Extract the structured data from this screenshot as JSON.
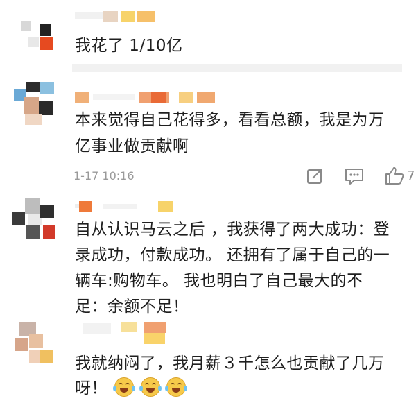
{
  "colors": {
    "text": "#1f1f1f",
    "meta": "#9a9a9a",
    "blur_orange": "#f08a3a",
    "blur_yellow": "#f7d36a",
    "blur_red": "#e24a2a"
  },
  "comments": [
    {
      "text": "我花了 1/10亿"
    },
    {
      "text_line1": "本来觉得自己花得多，看看总额，我是为万",
      "text_line2": "亿事业做贡献啊",
      "time": "1-17 10:16",
      "like_count": "7",
      "icons": [
        "share-icon",
        "comment-icon",
        "like-icon"
      ]
    },
    {
      "text_line1": "自从认识马云之后 ，我获得了两大成功：登",
      "text_line2": "录成功，付款成功。 还拥有了属于自己的一",
      "text_line3": "辆车:购物车。 我也明白了自己最大的不",
      "text_line4": "足：余额不足！"
    },
    {
      "text_line1": "我就纳闷了，我月薪３千怎么也贡献了几万",
      "text_line2": "呀！",
      "emojis": [
        "laugh-cry-emoji",
        "laugh-cry-emoji",
        "laugh-cry-emoji"
      ]
    }
  ]
}
